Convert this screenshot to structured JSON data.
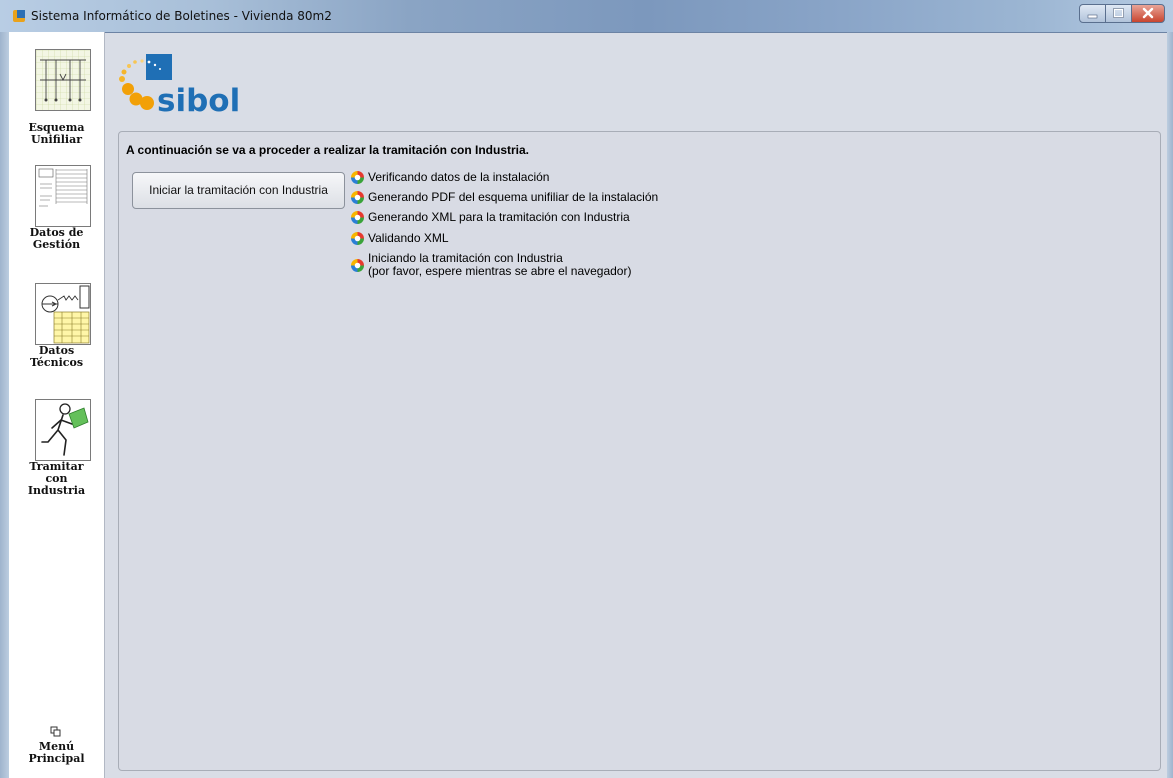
{
  "window": {
    "title": "Sistema Informático de Boletines - Vivienda 80m2"
  },
  "sidebar": {
    "items": [
      {
        "label_line1": "Esquema",
        "label_line2": "Unifiliar",
        "label_line3": ""
      },
      {
        "label_line1": "Datos de",
        "label_line2": "Gestión",
        "label_line3": ""
      },
      {
        "label_line1": "Datos",
        "label_line2": "Técnicos",
        "label_line3": ""
      },
      {
        "label_line1": "Tramitar",
        "label_line2": "con",
        "label_line3": "Industria"
      }
    ],
    "main_menu": {
      "label_line1": "Menú",
      "label_line2": "Principal"
    }
  },
  "logo": {
    "text": "sibol"
  },
  "panel": {
    "intro": "A continuación se va a proceder a realizar la tramitación con Industria.",
    "start_button": "Iniciar la tramitación con Industria",
    "steps": [
      {
        "line1": "Verificando datos de la instalación",
        "line2": ""
      },
      {
        "line1": "Generando PDF del esquema unifiliar de la instalación",
        "line2": ""
      },
      {
        "line1": "Generando XML para la tramitación con Industria",
        "line2": ""
      },
      {
        "line1": "Validando XML",
        "line2": ""
      },
      {
        "line1": "Iniciando la tramitación con Industria",
        "line2": "(por favor, espere mientras se abre el navegador)"
      }
    ]
  },
  "colors": {
    "accent_blue": "#1f6fb5",
    "logo_orange": "#f2a007",
    "spinner_colors": [
      "#e63a2e",
      "#f7b500",
      "#3aa33a",
      "#2a7fd6"
    ]
  }
}
